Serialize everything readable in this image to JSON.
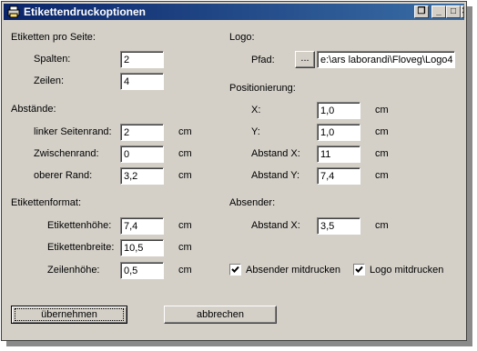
{
  "window": {
    "title": "Etikettendruckoptionen"
  },
  "titlebar_buttons": {
    "restore": "❐",
    "minimize": "_",
    "maximize": "□",
    "close": "✕"
  },
  "labels_per_page": {
    "heading": "Etiketten pro Seite:",
    "columns_label": "Spalten:",
    "columns_value": "2",
    "rows_label": "Zeilen:",
    "rows_value": "4"
  },
  "spacing": {
    "heading": "Abstände:",
    "left_margin_label": "linker Seitenrand:",
    "left_margin_value": "2",
    "left_margin_unit": "cm",
    "gap_label": "Zwischenrand:",
    "gap_value": "0",
    "gap_unit": "cm",
    "top_margin_label": "oberer Rand:",
    "top_margin_value": "3,2",
    "top_margin_unit": "cm"
  },
  "label_format": {
    "heading": "Etikettenformat:",
    "height_label": "Etikettenhöhe:",
    "height_value": "7,4",
    "height_unit": "cm",
    "width_label": "Etikettenbreite:",
    "width_value": "10,5",
    "width_unit": "cm",
    "line_height_label": "Zeilenhöhe:",
    "line_height_value": "0,5",
    "line_height_unit": "cm"
  },
  "logo": {
    "heading": "Logo:",
    "path_label": "Pfad:",
    "browse_label": "...",
    "path_value": "e:\\ars laborandi\\Floveg\\Logo4"
  },
  "positioning": {
    "heading": "Positionierung:",
    "x_label": "X:",
    "x_value": "1,0",
    "x_unit": "cm",
    "y_label": "Y:",
    "y_value": "1,0",
    "y_unit": "cm",
    "dist_x_label": "Abstand X:",
    "dist_x_value": "11",
    "dist_x_unit": "cm",
    "dist_y_label": "Abstand Y:",
    "dist_y_value": "7,4",
    "dist_y_unit": "cm"
  },
  "sender": {
    "heading": "Absender:",
    "dist_x_label": "Abstand X:",
    "dist_x_value": "3,5",
    "dist_x_unit": "cm"
  },
  "options": {
    "print_sender_label": "Absender mitdrucken",
    "print_sender_checked": true,
    "print_logo_label": "Logo mitdrucken",
    "print_logo_checked": true
  },
  "actions": {
    "apply_label": "übernehmen",
    "cancel_label": "abbrechen"
  }
}
